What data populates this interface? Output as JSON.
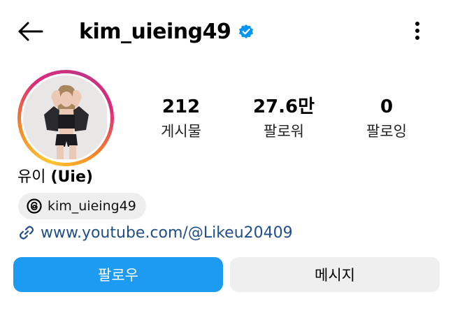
{
  "header": {
    "username": "kim_uieing49",
    "verified": true
  },
  "profile": {
    "display_name": "유이",
    "display_name_extra": "(Uie)",
    "threads_handle": "kim_uieing49",
    "link": "www.youtube.com/@Likeu20409"
  },
  "stats": [
    {
      "value": "212",
      "label": "게시물"
    },
    {
      "value": "27.6만",
      "label": "팔로워"
    },
    {
      "value": "0",
      "label": "팔로잉"
    }
  ],
  "actions": {
    "follow_label": "팔로우",
    "message_label": "메시지"
  },
  "colors": {
    "accent_blue": "#1d9bf0",
    "link_blue": "#1f4e8a",
    "verified_blue": "#0095f6",
    "secondary_button": "#efeff0"
  },
  "icons": {
    "back": "arrow-left-icon",
    "verified": "verified-badge-icon",
    "more": "more-vertical-icon",
    "threads": "threads-logo-icon",
    "link": "link-icon"
  }
}
